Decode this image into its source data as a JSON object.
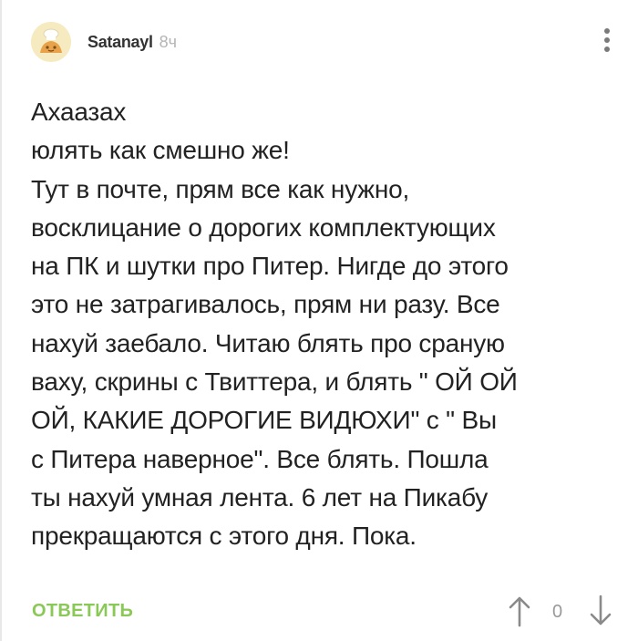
{
  "comment": {
    "author": "Satanayl",
    "time": "8ч",
    "body_lines": [
      "Ахаазах",
      "юлять как смешно же!",
      "Тут в почте, прям все как нужно,",
      "восклицание о дорогих комплектующих",
      "на ПК и шутки про Питер. Нигде до этого",
      "это не затрагивалось, прям ни разу. Все",
      "нахуй заебало. Читаю блять про сраную",
      "ваху, скрины с Твиттера, и блять \" ОЙ ОЙ",
      "ОЙ, КАКИЕ ДОРОГИЕ ВИДЮХИ\" с \" Вы",
      "с Питера наверное\". Все блять. Пошла",
      "ты нахуй умная лента. 6 лет на Пикабу",
      "прекращаются с этого дня. Пока."
    ],
    "reply_label": "ОТВЕТИТЬ",
    "rating": "0"
  },
  "icons": {
    "avatar": "avatar-image",
    "more": "more-vertical-icon",
    "up": "arrow-up-icon",
    "down": "arrow-down-icon"
  },
  "colors": {
    "reply": "#8ac858",
    "muted": "#b5b5b5",
    "text": "#222222"
  }
}
